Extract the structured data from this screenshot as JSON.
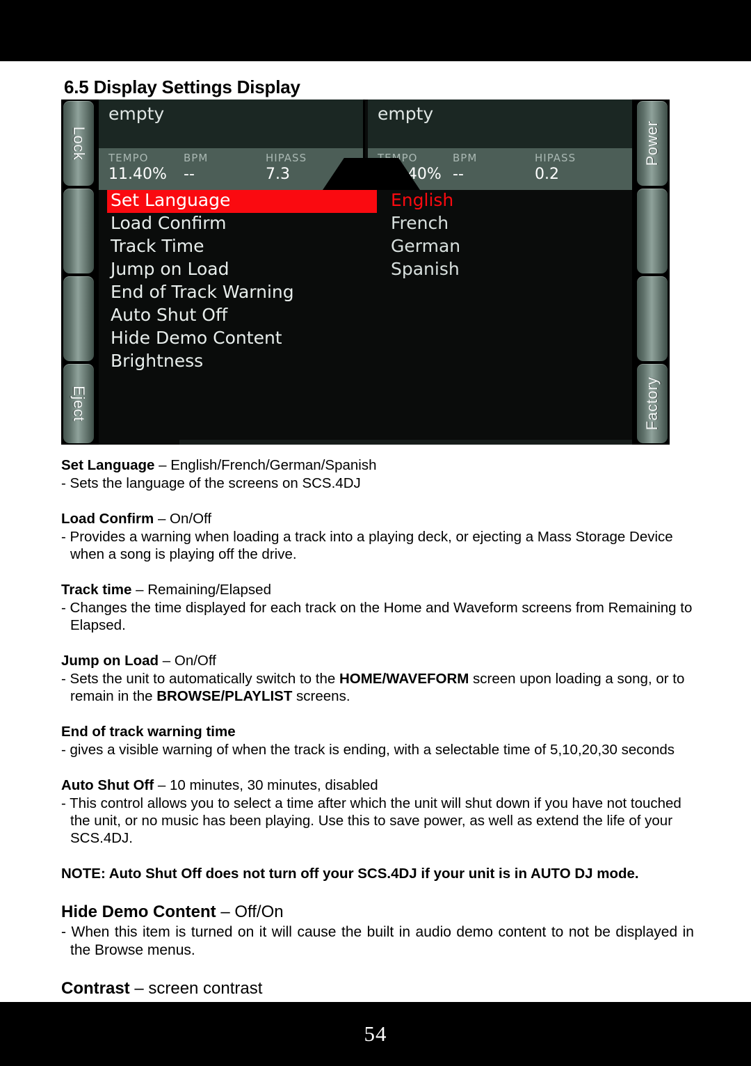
{
  "section": {
    "number": "6.5",
    "title": "6.5 Display Settings Display"
  },
  "device_screen": {
    "hardware_buttons": {
      "left": [
        "Lock",
        "",
        "",
        "Eject"
      ],
      "right": [
        "Power",
        "",
        "",
        "Factory"
      ]
    },
    "decks": [
      {
        "title": "empty",
        "fields": [
          {
            "label": "TEMPO",
            "value": "11.40%"
          },
          {
            "label": "BPM",
            "value": "--"
          },
          {
            "label": "HIPASS",
            "value": "7.3"
          }
        ]
      },
      {
        "title": "empty",
        "fields": [
          {
            "label": "TEMPO",
            "value": "-22.40%"
          },
          {
            "label": "BPM",
            "value": "--"
          },
          {
            "label": "HIPASS",
            "value": "0.2"
          }
        ]
      }
    ],
    "menu_items": [
      "Set Language",
      "Load Confirm",
      "Track Time",
      "Jump on Load",
      "End of Track Warning",
      "Auto Shut Off",
      "Hide Demo Content",
      "Brightness"
    ],
    "selected_menu_index": 0,
    "options": [
      "English",
      "French",
      "German",
      "Spanish"
    ],
    "selected_option_index": 0,
    "colors": {
      "highlight": "#fa0a10",
      "deck_panel": "#1b2723",
      "deck_info_strip": "#4c5e57",
      "screen_background": "#0a0c0b"
    }
  },
  "body": {
    "set_language": {
      "heading_bold": "Set Language",
      "heading_rest": " – English/French/German/Spanish",
      "line1": "- Sets the language of the screens on SCS.4DJ"
    },
    "load_confirm": {
      "heading_bold": "Load Confirm",
      "heading_rest": " – On/Off",
      "line1": "- Provides a warning when loading a track into a playing deck, or ejecting a Mass Storage Device when a song is playing off the drive."
    },
    "track_time": {
      "heading_bold": "Track time",
      "heading_rest": " – Remaining/Elapsed",
      "line1": "- Changes the time displayed for each track on the Home and Waveform screens from Remaining to Elapsed."
    },
    "jump_on_load": {
      "heading_bold": "Jump on Load",
      "heading_rest": " – On/Off",
      "part1": "- Sets the unit to automatically switch to the ",
      "bold1": "HOME/WAVEFORM",
      "part2": " screen upon loading a song, or to remain in the ",
      "bold2": "BROWSE/PLAYLIST",
      "part3": " screens."
    },
    "end_of_track": {
      "heading_bold": "End of track warning time",
      "heading_rest": "",
      "line1": " - gives a visible warning of when the track is ending, with a selectable time of 5,10,20,30 seconds"
    },
    "auto_shut_off": {
      "heading_bold": "Auto Shut Off",
      "heading_rest": " – 10 minutes, 30 minutes, disabled",
      "line1": "- This control allows you to select a time after which the unit will shut down if you have not touched the unit, or no music has been playing. Use this to save power, as well as extend the life of your SCS.4DJ."
    },
    "note": "NOTE: Auto Shut Off does not turn off your SCS.4DJ if your unit is in AUTO DJ mode.",
    "hide_demo": {
      "heading_bold": "Hide Demo Content",
      "heading_rest": " – Off/On",
      "line1": "- When this item is turned on it will cause the built in audio demo content to not be displayed in the Browse menus."
    },
    "contrast": {
      "heading_bold": "Contrast",
      "heading_rest": " – screen contrast"
    }
  },
  "footer": {
    "page_number": "54"
  }
}
